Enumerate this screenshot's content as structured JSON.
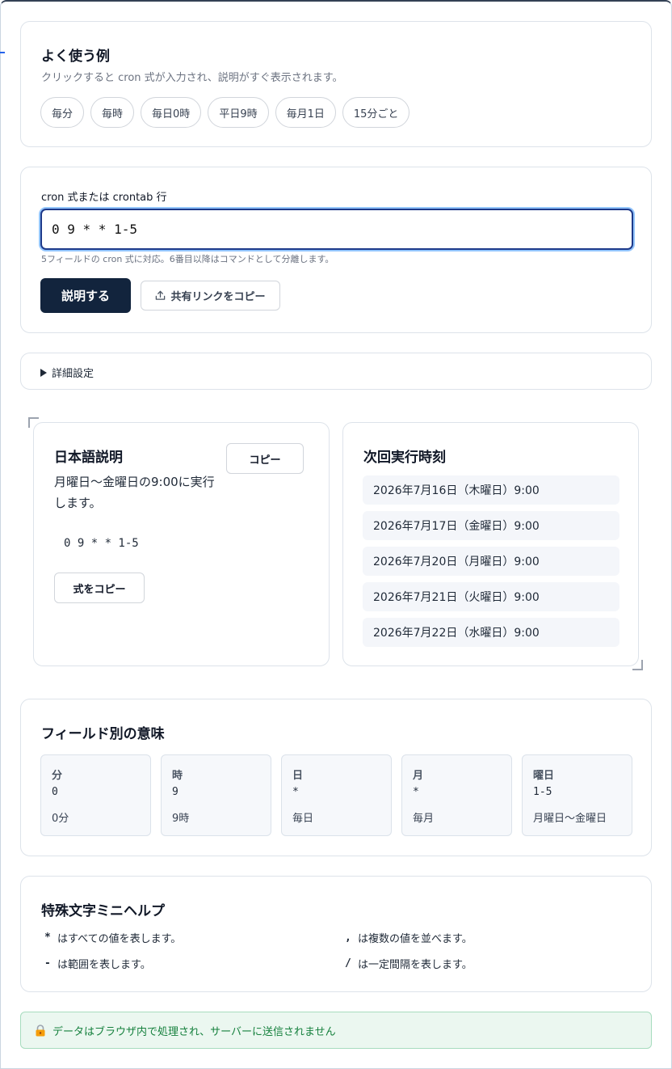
{
  "examples": {
    "title": "よく使う例",
    "subtitle": "クリックすると cron 式が入力され、説明がすぐ表示されます。",
    "chips": [
      "毎分",
      "毎時",
      "毎日0時",
      "平日9時",
      "毎月1日",
      "15分ごと"
    ]
  },
  "input": {
    "label": "cron 式または crontab 行",
    "value": "0 9 * * 1-5",
    "hint": "5フィールドの cron 式に対応。6番目以降はコマンドとして分離します。",
    "explain_button": "説明する",
    "share_button": "共有リンクをコピー"
  },
  "details": {
    "label": "詳細設定"
  },
  "description": {
    "title": "日本語説明",
    "copy_button": "コピー",
    "text": "月曜日〜金曜日の9:00に実行します。",
    "expression": "0 9 * * 1-5",
    "copy_expr_button": "式をコピー"
  },
  "next_runs": {
    "title": "次回実行時刻",
    "items": [
      "2026年7月16日（木曜日）9:00",
      "2026年7月17日（金曜日）9:00",
      "2026年7月20日（月曜日）9:00",
      "2026年7月21日（火曜日）9:00",
      "2026年7月22日（水曜日）9:00"
    ]
  },
  "fields": {
    "title": "フィールド別の意味",
    "items": [
      {
        "name": "分",
        "value": "0",
        "meaning": "0分"
      },
      {
        "name": "時",
        "value": "9",
        "meaning": "9時"
      },
      {
        "name": "日",
        "value": "*",
        "meaning": "毎日"
      },
      {
        "name": "月",
        "value": "*",
        "meaning": "毎月"
      },
      {
        "name": "曜日",
        "value": "1-5",
        "meaning": "月曜日〜金曜日"
      }
    ]
  },
  "help": {
    "title": "特殊文字ミニヘルプ",
    "items": [
      {
        "symbol": "*",
        "text": "はすべての値を表します。"
      },
      {
        "symbol": ",",
        "text": "は複数の値を並べます。"
      },
      {
        "symbol": "-",
        "text": "は範囲を表します。"
      },
      {
        "symbol": "/",
        "text": "は一定間隔を表します。"
      }
    ]
  },
  "notice": {
    "text": "データはブラウザ内で処理され、サーバーに送信されません",
    "icon": "lock-icon"
  },
  "colors": {
    "primary": "#12243d",
    "accent": "#1e3a8a",
    "success": "#15803d"
  }
}
